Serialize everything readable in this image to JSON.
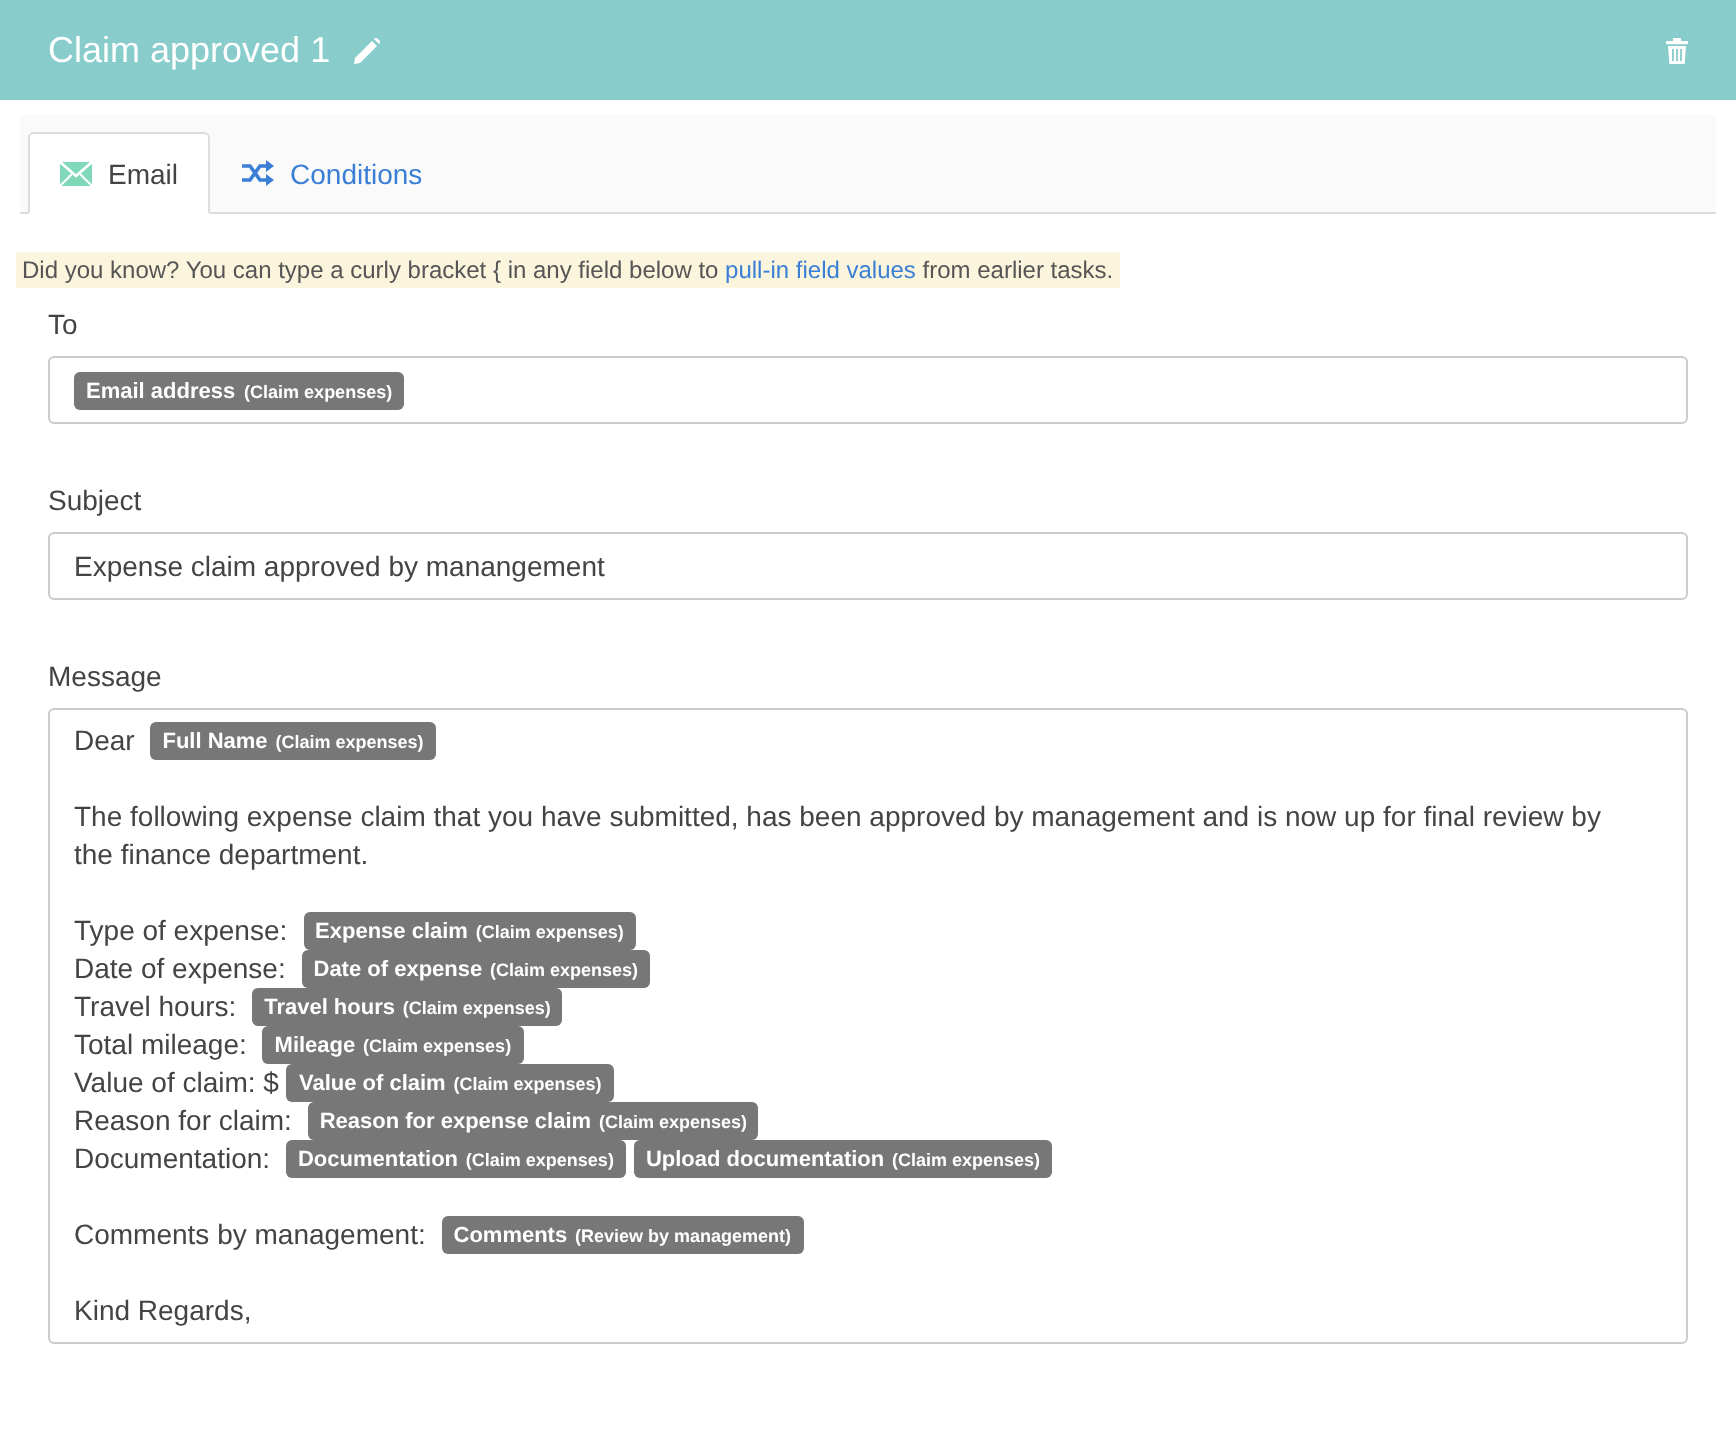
{
  "header": {
    "title": "Claim approved 1"
  },
  "tabs": [
    {
      "label": "Email",
      "kind": "envelope",
      "selected": true
    },
    {
      "label": "Conditions",
      "kind": "shuffle",
      "selected": false
    }
  ],
  "hint": {
    "before": "Did you know? You can type a curly bracket { in any field below to ",
    "link": "pull-in field values",
    "after": " from earlier tasks."
  },
  "fields": [
    {
      "label": "To",
      "kind": "tokens",
      "tokens": [
        {
          "field": "Email address",
          "source": "(Claim expenses)"
        }
      ]
    },
    {
      "label": "Subject",
      "kind": "text",
      "value": "Expense claim approved by manangement"
    }
  ],
  "message": {
    "label": "Message",
    "lines": [
      {
        "kind": "line",
        "parts": [
          {
            "kind": "text",
            "text": "Dear "
          },
          {
            "kind": "token",
            "field": "Full Name",
            "source": "(Claim expenses)"
          }
        ]
      },
      {
        "kind": "gap"
      },
      {
        "kind": "line",
        "parts": [
          {
            "kind": "text",
            "text": "The following expense claim that you have submitted, has been approved by management and is now up for final review by the finance department."
          }
        ]
      },
      {
        "kind": "gap"
      },
      {
        "kind": "line",
        "parts": [
          {
            "kind": "text",
            "text": "Type of expense: "
          },
          {
            "kind": "token",
            "field": "Expense claim",
            "source": "(Claim expenses)"
          }
        ]
      },
      {
        "kind": "line",
        "parts": [
          {
            "kind": "text",
            "text": "Date of expense: "
          },
          {
            "kind": "token",
            "field": "Date of expense",
            "source": "(Claim expenses)"
          }
        ]
      },
      {
        "kind": "line",
        "parts": [
          {
            "kind": "text",
            "text": "Travel hours: "
          },
          {
            "kind": "token",
            "field": "Travel hours",
            "source": "(Claim expenses)"
          }
        ]
      },
      {
        "kind": "line",
        "parts": [
          {
            "kind": "text",
            "text": "Total mileage: "
          },
          {
            "kind": "token",
            "field": "Mileage",
            "source": "(Claim expenses)"
          }
        ]
      },
      {
        "kind": "line",
        "parts": [
          {
            "kind": "text",
            "text": "Value of claim: $"
          },
          {
            "kind": "token",
            "field": "Value of claim",
            "source": "(Claim expenses)"
          }
        ]
      },
      {
        "kind": "line",
        "parts": [
          {
            "kind": "text",
            "text": "Reason for claim: "
          },
          {
            "kind": "token",
            "field": "Reason for expense claim",
            "source": "(Claim expenses)"
          }
        ]
      },
      {
        "kind": "line",
        "parts": [
          {
            "kind": "text",
            "text": "Documentation: "
          },
          {
            "kind": "token",
            "field": "Documentation",
            "source": "(Claim expenses)"
          },
          {
            "kind": "token",
            "field": "Upload documentation",
            "source": "(Claim expenses)"
          }
        ]
      },
      {
        "kind": "gap"
      },
      {
        "kind": "line",
        "parts": [
          {
            "kind": "text",
            "text": "Comments by management: "
          },
          {
            "kind": "token",
            "field": "Comments",
            "source": "(Review by management)"
          }
        ]
      },
      {
        "kind": "gap"
      },
      {
        "kind": "line",
        "parts": [
          {
            "kind": "text",
            "text": "Kind Regards,"
          }
        ]
      }
    ]
  }
}
